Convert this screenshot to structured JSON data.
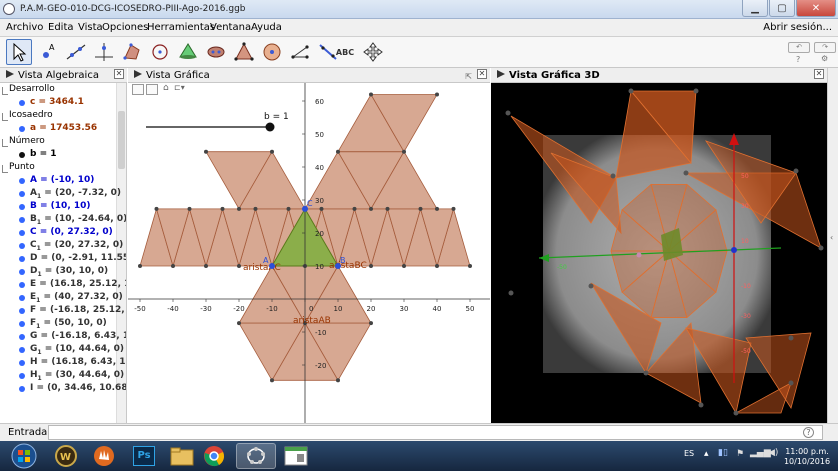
{
  "window": {
    "title": "P.A.M-GEO-010-DCG-ICOSEDRO-PIII-Ago-2016.ggb",
    "minimize": "▁",
    "maximize": "▢",
    "close": "✕"
  },
  "menu": {
    "items": [
      "Archivo",
      "Edita",
      "Vista",
      "Opciones",
      "Herramientas",
      "Ventana",
      "Ayuda"
    ],
    "signin": "Abrir sesión..."
  },
  "toolbar": {
    "text_tool": "ABC",
    "undo": "↶",
    "redo": "↷",
    "help": "?",
    "settings": "⚙"
  },
  "algebra": {
    "title": "Vista Algebraica",
    "groups": [
      {
        "name": "Desarrollo",
        "items": [
          {
            "text": "c = 3464.1",
            "color": "#993300",
            "bullet": "#3366ff"
          }
        ]
      },
      {
        "name": "Icosaedro",
        "items": [
          {
            "text": "a = 17453.56",
            "color": "#993300",
            "bullet": "#3366ff"
          }
        ]
      },
      {
        "name": "Número",
        "items": [
          {
            "text": "b = 1",
            "color": "#000000",
            "bullet": "#111111"
          }
        ]
      },
      {
        "name": "Punto",
        "items": [
          {
            "label": "A",
            "sub": "",
            "val": " = (-10, 10)",
            "color": "#0000cc",
            "bullet": "#3366ff"
          },
          {
            "label": "A",
            "sub": "1",
            "val": " = (20, -7.32, 0)",
            "color": "#333333",
            "bullet": "#3366ff"
          },
          {
            "label": "B",
            "sub": "",
            "val": " = (10, 10)",
            "color": "#0000cc",
            "bullet": "#3366ff"
          },
          {
            "label": "B",
            "sub": "1",
            "val": " = (10, -24.64, 0)",
            "color": "#333333",
            "bullet": "#3366ff"
          },
          {
            "label": "C",
            "sub": "",
            "val": " = (0, 27.32, 0)",
            "color": "#0000cc",
            "bullet": "#3366ff"
          },
          {
            "label": "C",
            "sub": "1",
            "val": " = (20, 27.32, 0)",
            "color": "#333333",
            "bullet": "#3366ff"
          },
          {
            "label": "D",
            "sub": "",
            "val": " = (0, -2.91, 11.55)",
            "color": "#333333",
            "bullet": "#3366ff"
          },
          {
            "label": "D",
            "sub": "1",
            "val": " = (30, 10, 0)",
            "color": "#333333",
            "bullet": "#3366ff"
          },
          {
            "label": "E",
            "sub": "",
            "val": " = (16.18, 25.12, 1",
            "color": "#333333",
            "bullet": "#3366ff"
          },
          {
            "label": "E",
            "sub": "1",
            "val": " = (40, 27.32, 0)",
            "color": "#333333",
            "bullet": "#3366ff"
          },
          {
            "label": "F",
            "sub": "",
            "val": " = (-16.18, 25.12,",
            "color": "#333333",
            "bullet": "#3366ff"
          },
          {
            "label": "F",
            "sub": "1",
            "val": " = (50, 10, 0)",
            "color": "#333333",
            "bullet": "#3366ff"
          },
          {
            "label": "G",
            "sub": "",
            "val": " = (-16.18, 6.43, 1",
            "color": "#333333",
            "bullet": "#3366ff"
          },
          {
            "label": "G",
            "sub": "1",
            "val": " = (10, 44.64, 0)",
            "color": "#333333",
            "bullet": "#3366ff"
          },
          {
            "label": "H",
            "sub": "",
            "val": " = (16.18, 6.43, 18",
            "color": "#333333",
            "bullet": "#3366ff"
          },
          {
            "label": "H",
            "sub": "1",
            "val": " = (30, 44.64, 0)",
            "color": "#333333",
            "bullet": "#3366ff"
          },
          {
            "label": "I",
            "sub": "",
            "val": " = (0, 34.46, 10.68)",
            "color": "#333333",
            "bullet": "#3366ff"
          }
        ]
      }
    ]
  },
  "graphics": {
    "title": "Vista Gráfica",
    "slider_label": "b = 1",
    "x_ticks": [
      "-50",
      "-40",
      "-30",
      "-20",
      "-10",
      "0",
      "10",
      "20",
      "30",
      "40",
      "50"
    ],
    "y_ticks": [
      "60",
      "50",
      "40",
      "30",
      "20",
      "10",
      "-10",
      "-20"
    ],
    "labels": {
      "aristaAC": "aristaAC",
      "aristaBC": "aristaBC",
      "aristaAB": "aristaAB",
      "A": "A",
      "B": "B",
      "C": "C"
    },
    "colors": {
      "net_fill": "#d39f86",
      "net_stroke": "#a55c3c",
      "base_fill": "#8bae4a",
      "label": "#993300"
    }
  },
  "view3d": {
    "title": "Vista Gráfica 3D",
    "z_ticks": [
      "50",
      "30",
      "10",
      "-10",
      "-30",
      "-50"
    ],
    "y_tick": "-50"
  },
  "input": {
    "label": "Entrada:",
    "value": "",
    "help": "?"
  },
  "taskbar": {
    "ps_label": "Ps",
    "lang": "ES",
    "time": "11:00 p.m.",
    "date": "10/10/2016"
  }
}
